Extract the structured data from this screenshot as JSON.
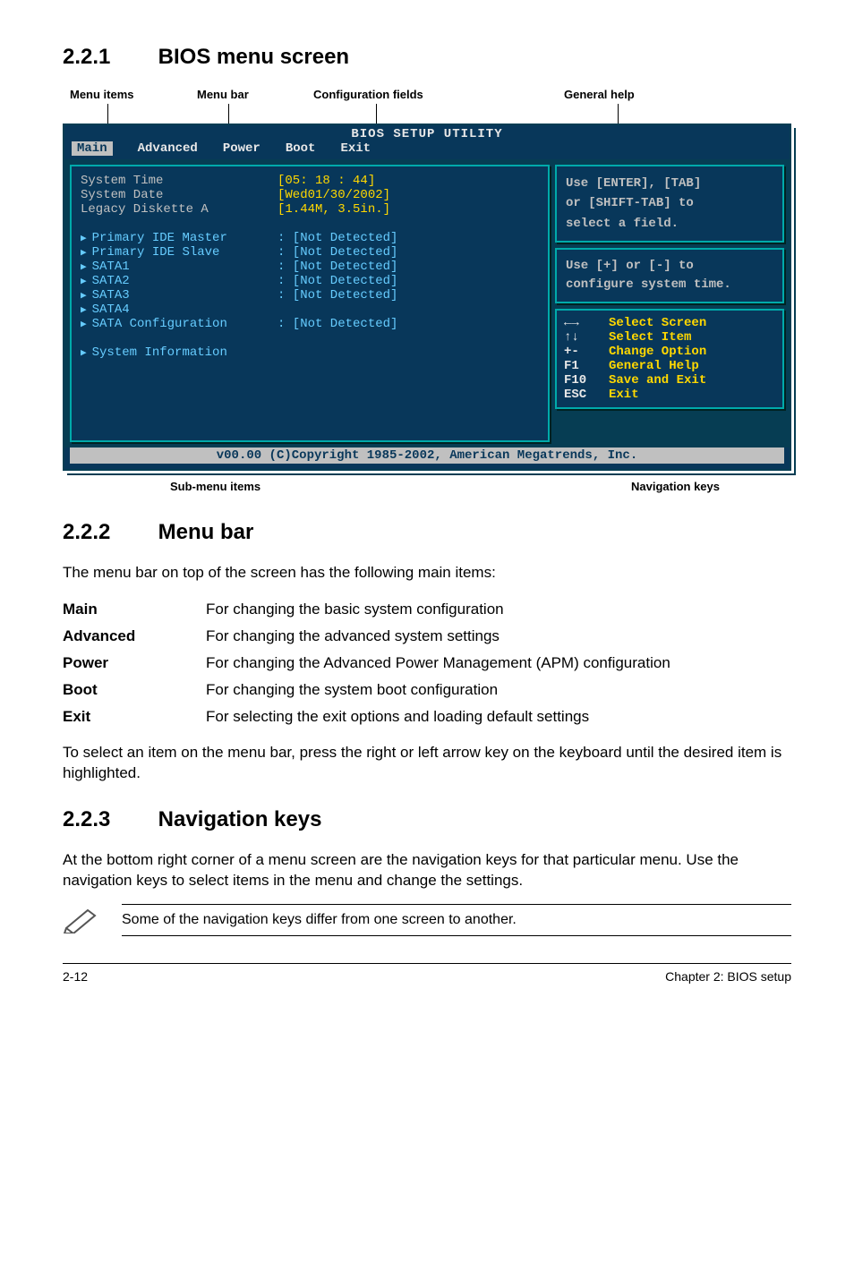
{
  "sections": {
    "s1": {
      "num": "2.2.1",
      "title": "BIOS menu screen"
    },
    "s2": {
      "num": "2.2.2",
      "title": "Menu bar"
    },
    "s3": {
      "num": "2.2.3",
      "title": "Navigation keys"
    }
  },
  "annot_top": {
    "a": "Menu items",
    "b": "Menu bar",
    "c": "Configuration fields",
    "d": "General help"
  },
  "bios": {
    "title": "BIOS SETUP UTILITY",
    "menubar": [
      "Main",
      "Advanced",
      "Power",
      "Boot",
      "Exit"
    ],
    "left_items": [
      {
        "label": "System Time",
        "value": "[05: 18 : 44]",
        "style": "top"
      },
      {
        "label": "System Date",
        "value": "[Wed01/30/2002]",
        "style": "top"
      },
      {
        "label": "Legacy Diskette A",
        "value": "[1.44M, 3.5in.]",
        "style": "top"
      },
      {
        "label": "",
        "value": ""
      },
      {
        "label": "Primary IDE Master",
        "value": ": [Not Detected]",
        "tri": true
      },
      {
        "label": "Primary IDE Slave",
        "value": ": [Not Detected]",
        "tri": true
      },
      {
        "label": "SATA1",
        "value": ": [Not Detected]",
        "tri": true
      },
      {
        "label": "SATA2",
        "value": ": [Not Detected]",
        "tri": true
      },
      {
        "label": "SATA3",
        "value": ": [Not Detected]",
        "tri": true
      },
      {
        "label": "SATA4",
        "value": "",
        "tri": true
      },
      {
        "label": "SATA Configuration",
        "value": ": [Not Detected]",
        "tri": true
      },
      {
        "label": "",
        "value": ""
      },
      {
        "label": "System Information",
        "value": "",
        "tri": true
      }
    ],
    "help1_lines": [
      "Use [ENTER], [TAB]",
      "or [SHIFT-TAB] to",
      "select a field."
    ],
    "help2_lines": [
      "Use [+] or [-] to",
      "configure system time."
    ],
    "nav": [
      {
        "k": "←→",
        "v": "Select Screen"
      },
      {
        "k": "↑↓",
        "v": "Select Item"
      },
      {
        "k": "+-",
        "v": "Change Option"
      },
      {
        "k": "F1",
        "v": "General Help"
      },
      {
        "k": "F10",
        "v": "Save and Exit"
      },
      {
        "k": "ESC",
        "v": "Exit"
      }
    ],
    "footer": "v00.00 (C)Copyright 1985-2002, American Megatrends, Inc."
  },
  "annot_bottom": {
    "a": "Sub-menu items",
    "b": "Navigation keys"
  },
  "menubar_intro": "The menu bar on top of the screen has the following main items:",
  "menubar_defs": [
    {
      "term": "Main",
      "desc": "For changing the basic system configuration"
    },
    {
      "term": "Advanced",
      "desc": "For changing the advanced system settings"
    },
    {
      "term": "Power",
      "desc": "For changing the Advanced Power Management (APM) configuration"
    },
    {
      "term": "Boot",
      "desc": "For changing the system boot configuration"
    },
    {
      "term": "Exit",
      "desc": "For selecting the exit options and loading default settings"
    }
  ],
  "menubar_outro": "To select an item on the menu bar, press the right or left arrow key on the keyboard until the desired item is highlighted.",
  "navkeys_text": "At the bottom right corner of a menu screen are the navigation keys for that particular menu. Use the navigation keys to select items in the menu and change the settings.",
  "note": "Some of the navigation keys differ from one screen to another.",
  "footer": {
    "left": "2-12",
    "right": "Chapter 2: BIOS setup"
  }
}
